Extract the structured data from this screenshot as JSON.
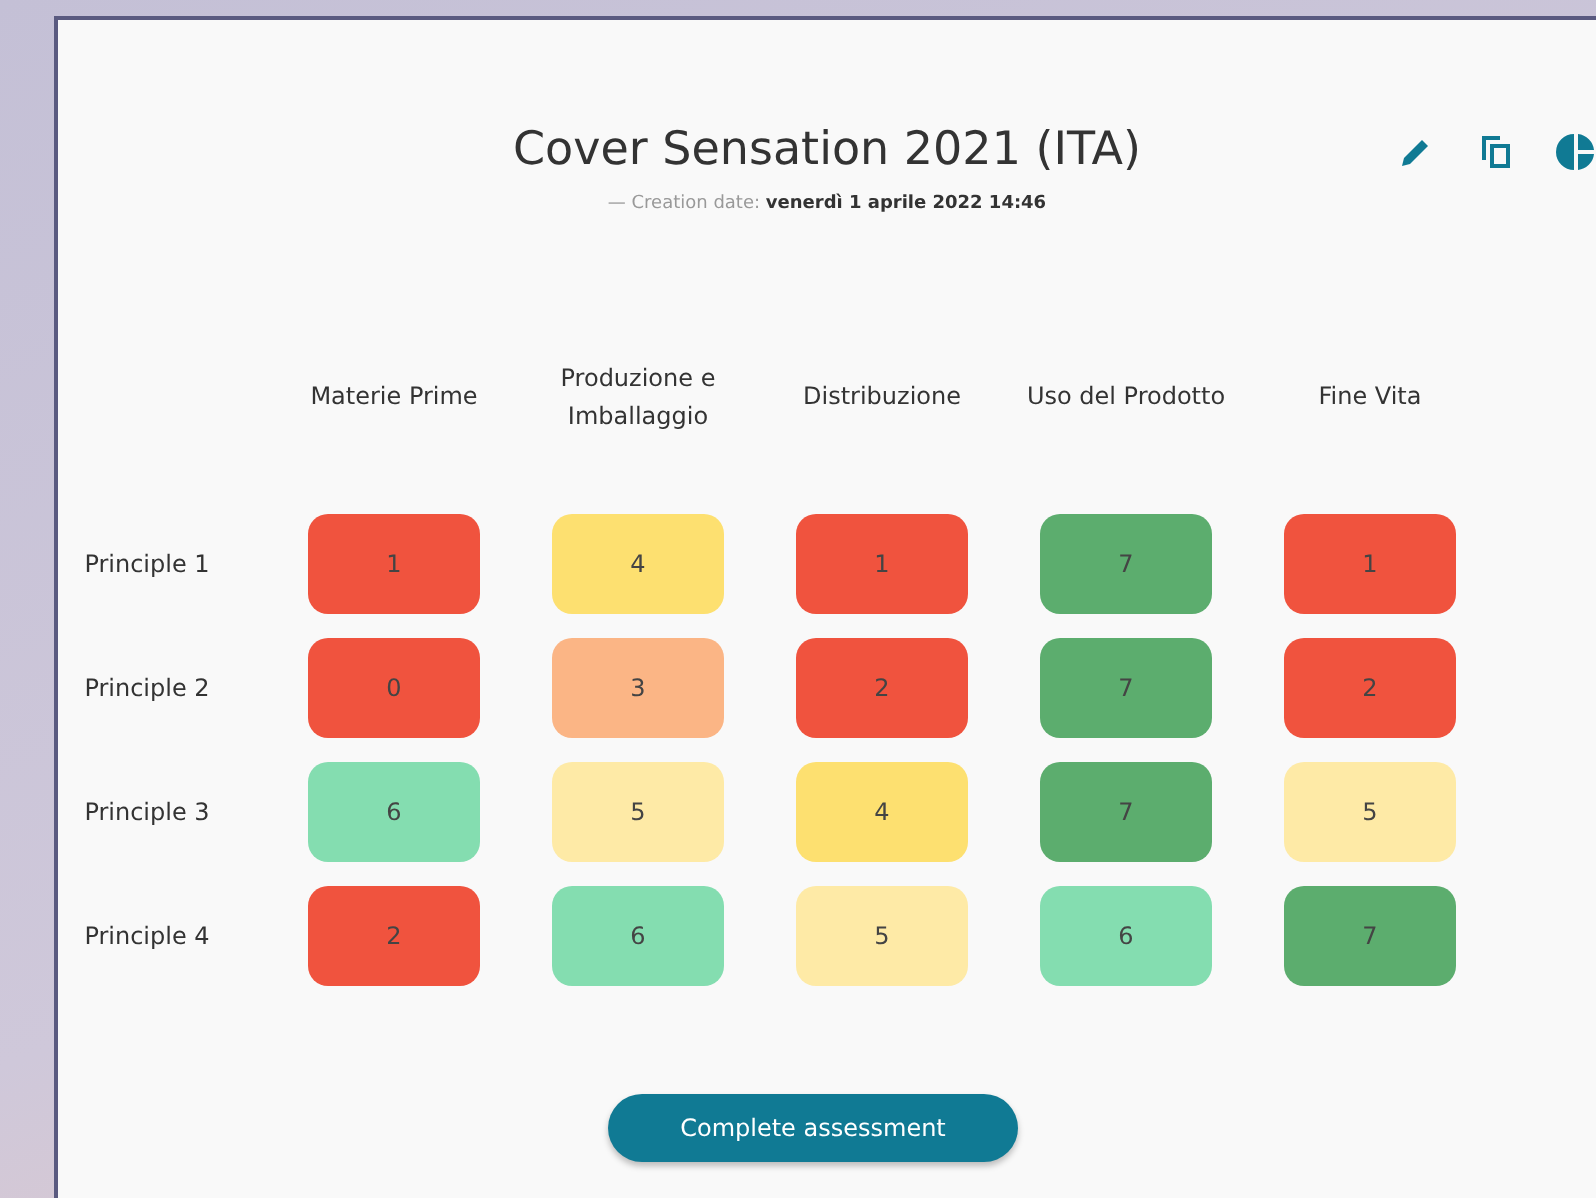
{
  "title": "Cover Sensation 2021 (ITA)",
  "subtitle": {
    "label": "— Creation date:",
    "date": "venerdì 1 aprile 2022 14:46"
  },
  "columns": [
    "Materie Prime",
    "Produzione e Imballaggio",
    "Distribuzione",
    "Uso del Prodotto",
    "Fine Vita"
  ],
  "rows": [
    {
      "label": "Principle 1",
      "cells": [
        {
          "value": "1",
          "color": "#f0533e"
        },
        {
          "value": "4",
          "color": "#fde070"
        },
        {
          "value": "1",
          "color": "#f0533e"
        },
        {
          "value": "7",
          "color": "#5cad6e"
        },
        {
          "value": "1",
          "color": "#f0533e"
        }
      ]
    },
    {
      "label": "Principle 2",
      "cells": [
        {
          "value": "0",
          "color": "#f0533e"
        },
        {
          "value": "3",
          "color": "#fbb585"
        },
        {
          "value": "2",
          "color": "#f0533e"
        },
        {
          "value": "7",
          "color": "#5cad6e"
        },
        {
          "value": "2",
          "color": "#f0533e"
        }
      ]
    },
    {
      "label": "Principle 3",
      "cells": [
        {
          "value": "6",
          "color": "#84ddb0"
        },
        {
          "value": "5",
          "color": "#feeaa6"
        },
        {
          "value": "4",
          "color": "#fde070"
        },
        {
          "value": "7",
          "color": "#5cad6e"
        },
        {
          "value": "5",
          "color": "#feeaa6"
        }
      ]
    },
    {
      "label": "Principle 4",
      "cells": [
        {
          "value": "2",
          "color": "#f0533e"
        },
        {
          "value": "6",
          "color": "#84ddb0"
        },
        {
          "value": "5",
          "color": "#feeaa6"
        },
        {
          "value": "6",
          "color": "#84ddb0"
        },
        {
          "value": "7",
          "color": "#5cad6e"
        }
      ]
    }
  ],
  "button": "Complete assessment"
}
